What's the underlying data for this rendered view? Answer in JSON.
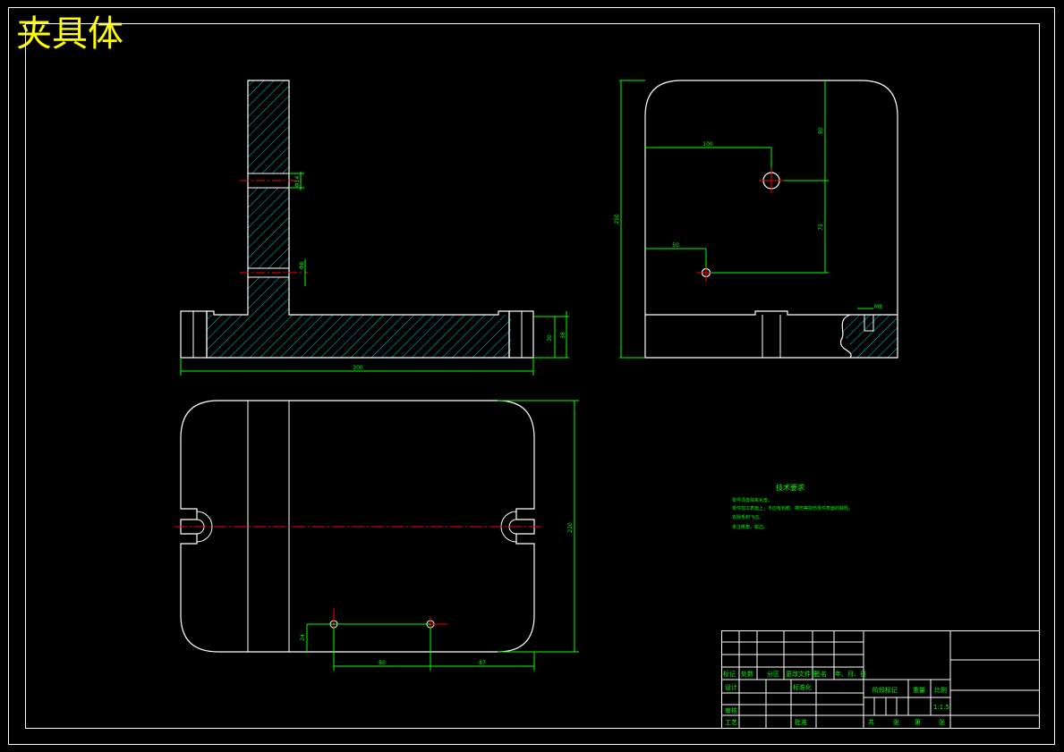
{
  "drawing": {
    "title": "夹具体",
    "tech": {
      "heading": "技术要求",
      "notes": [
        "零件须去除氧化皮。",
        "零件加工表面上，不应有划痕、擦伤等损伤零件表面的缺陷。",
        "去除毛刺飞边。",
        "未注倒角，锐边。"
      ]
    },
    "title_block": {
      "rev_headers": [
        "标记",
        "处数",
        "分区",
        "更改文件号",
        "签名",
        "年、月、日"
      ],
      "design": "设计",
      "standardize": "标准化",
      "check": "审核",
      "process": "工艺",
      "approve": "批准",
      "stage_mark": "阶段标记",
      "weight": "重量",
      "scale_label": "比例",
      "scale": "1:1.5",
      "sheets": [
        "共",
        "张",
        "第",
        "张"
      ]
    },
    "dimensions": {
      "front": {
        "hole_upper": "Φ14",
        "hole_lower": "Φ8",
        "height_inner": "30",
        "height_outer": "38",
        "length": "300"
      },
      "side": {
        "hole_x": "100",
        "hole_y": "80",
        "small_x": "50",
        "offset": "75",
        "total_height": "250",
        "thread": "M8"
      },
      "top": {
        "width": "220",
        "hole_spacing": "80",
        "hole_edge": "87",
        "hole_offset": "24"
      }
    },
    "colors": {
      "outline": "#ffffff",
      "dimension": "#00ff00",
      "hatch": "#00ffff",
      "center": "#ff0000",
      "title": "#ffff00"
    }
  }
}
